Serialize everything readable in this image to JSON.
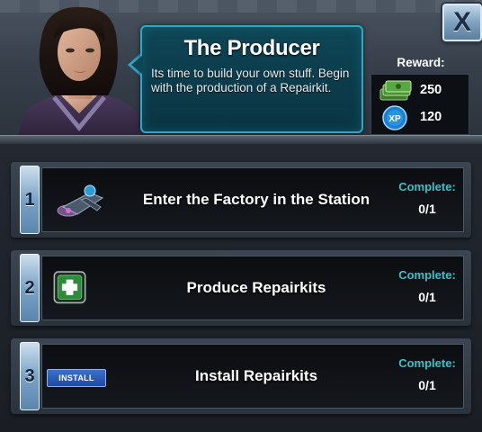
{
  "quest": {
    "title": "The Producer",
    "description": "Its time to build your own stuff. Begin with the production of a Repairkit."
  },
  "reward": {
    "label": "Reward:",
    "items": [
      {
        "icon": "cash-icon",
        "value": "250"
      },
      {
        "icon": "xp-icon",
        "badge": "XP",
        "value": "120"
      }
    ]
  },
  "close": {
    "label": "X"
  },
  "objectives": [
    {
      "number": "1",
      "text": "Enter the Factory in the Station",
      "icon": "station-icon",
      "complete_label": "Complete:",
      "progress": "0/1"
    },
    {
      "number": "2",
      "text": "Produce Repairkits",
      "icon": "repairkit-icon",
      "complete_label": "Complete:",
      "progress": "0/1"
    },
    {
      "number": "3",
      "text": "Install Repairkits",
      "icon": "install-icon",
      "badge": "INSTALL",
      "complete_label": "Complete:",
      "progress": "0/1"
    }
  ],
  "colors": {
    "accent_teal": "#33c3c8",
    "dialog_border": "#2fa6c6",
    "dialog_bg": "#0e4656",
    "number_tab": "#7aa3c6"
  }
}
